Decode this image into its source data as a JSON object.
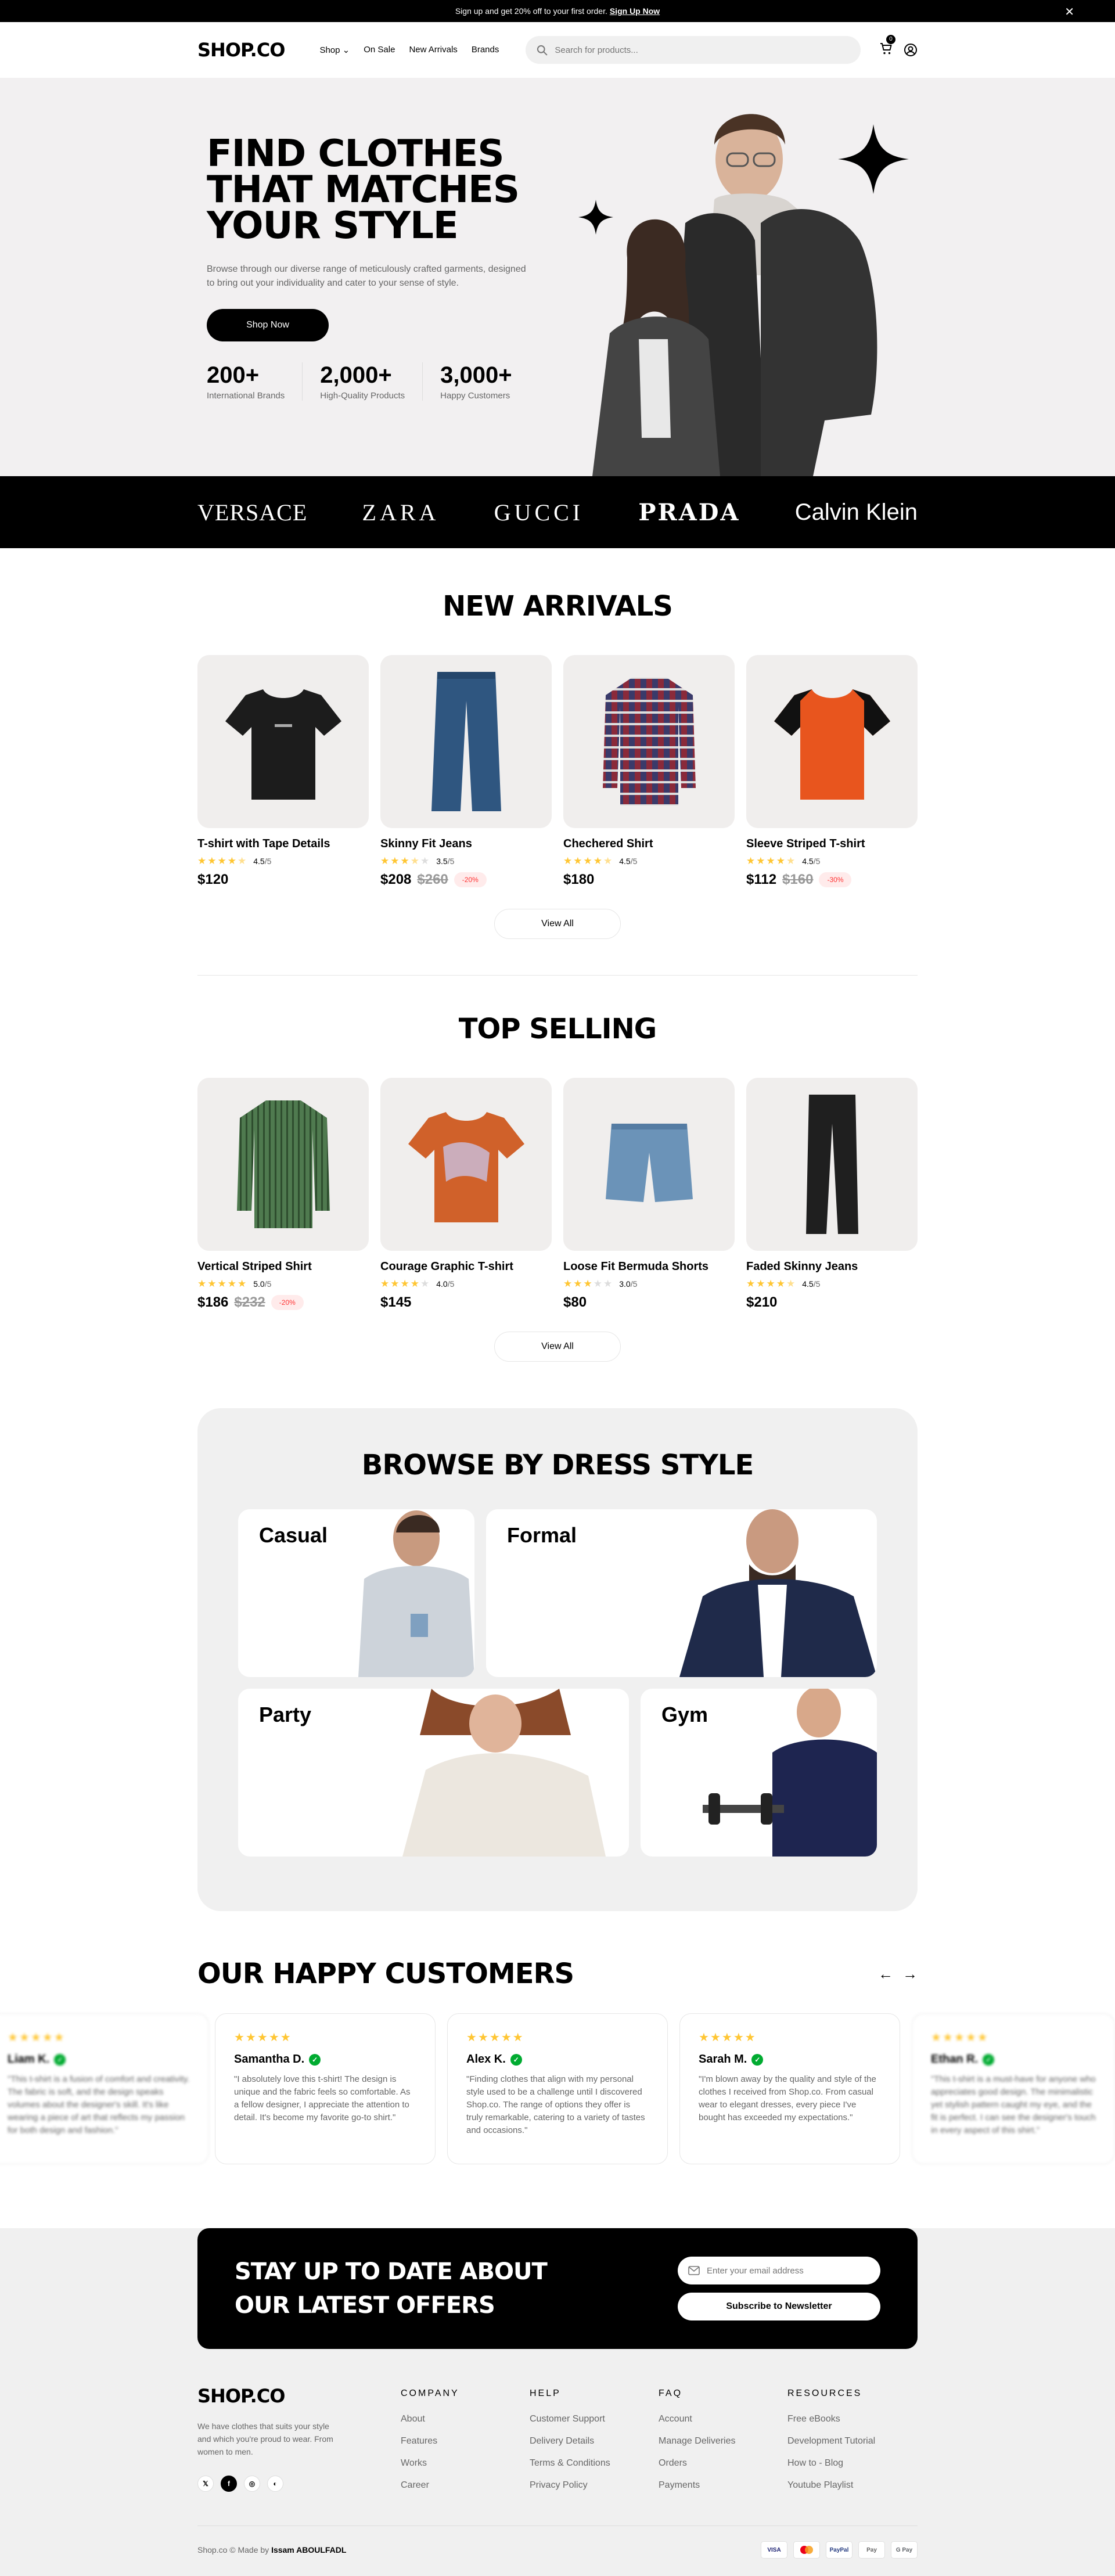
{
  "banner": {
    "text": "Sign up and get 20% off to your first order.",
    "link": "Sign Up Now"
  },
  "nav": {
    "logo": "SHOP.CO",
    "menu": [
      "Shop",
      "On Sale",
      "New Arrivals",
      "Brands"
    ],
    "search_placeholder": "Search for products...",
    "cart_count": "0"
  },
  "hero": {
    "title": "FIND CLOTHES THAT MATCHES YOUR STYLE",
    "description": "Browse through our diverse range of meticulously crafted garments, designed to bring out your individuality and cater to your sense of style.",
    "cta": "Shop Now",
    "stats": [
      {
        "num": "200+",
        "label": "International Brands"
      },
      {
        "num": "2,000+",
        "label": "High-Quality Products"
      },
      {
        "num": "3,000+",
        "label": "Happy Customers"
      }
    ]
  },
  "brands": [
    "VERSACE",
    "ZARA",
    "GUCCI",
    "PRADA",
    "Calvin Klein"
  ],
  "new_arrivals": {
    "title": "NEW ARRIVALS",
    "view_all": "View All",
    "products": [
      {
        "name": "T-shirt with Tape Details",
        "stars": 4.5,
        "score": "4.5",
        "price": "$120",
        "old": "",
        "discount": ""
      },
      {
        "name": "Skinny Fit Jeans",
        "stars": 3.5,
        "score": "3.5",
        "price": "$208",
        "old": "$260",
        "discount": "-20%"
      },
      {
        "name": "Chechered Shirt",
        "stars": 4.5,
        "score": "4.5",
        "price": "$180",
        "old": "",
        "discount": ""
      },
      {
        "name": "Sleeve Striped T-shirt",
        "stars": 4.5,
        "score": "4.5",
        "price": "$112",
        "old": "$160",
        "discount": "-30%"
      }
    ]
  },
  "top_selling": {
    "title": "TOP SELLING",
    "view_all": "View All",
    "products": [
      {
        "name": "Vertical Striped Shirt",
        "stars": 5.0,
        "score": "5.0",
        "price": "$186",
        "old": "$232",
        "discount": "-20%"
      },
      {
        "name": "Courage Graphic T-shirt",
        "stars": 4.0,
        "score": "4.0",
        "price": "$145",
        "old": "",
        "discount": ""
      },
      {
        "name": "Loose Fit Bermuda Shorts",
        "stars": 3.0,
        "score": "3.0",
        "price": "$80",
        "old": "",
        "discount": ""
      },
      {
        "name": "Faded Skinny Jeans",
        "stars": 4.5,
        "score": "4.5",
        "price": "$210",
        "old": "",
        "discount": ""
      }
    ]
  },
  "score_suffix": "/5",
  "browse": {
    "title": "BROWSE BY DRESS STYLE",
    "tiles": [
      "Casual",
      "Formal",
      "Party",
      "Gym"
    ]
  },
  "testimonials": {
    "title": "OUR HAPPY CUSTOMERS",
    "reviews": [
      {
        "name": "Liam K.",
        "text": "\"This t-shirt is a fusion of comfort and creativity. The fabric is soft, and the design speaks volumes about the designer's skill. It's like wearing a piece of art that reflects my passion for both design and fashion.\""
      },
      {
        "name": "Samantha D.",
        "text": "\"I absolutely love this t-shirt! The design is unique and the fabric feels so comfortable. As a fellow designer, I appreciate the attention to detail. It's become my favorite go-to shirt.\""
      },
      {
        "name": "Alex K.",
        "text": "\"Finding clothes that align with my personal style used to be a challenge until I discovered Shop.co. The range of options they offer is truly remarkable, catering to a variety of tastes and occasions.\""
      },
      {
        "name": "Sarah M.",
        "text": "\"I'm blown away by the quality and style of the clothes I received from Shop.co. From casual wear to elegant dresses, every piece I've bought has exceeded my expectations.\""
      },
      {
        "name": "Ethan R.",
        "text": "\"This t-shirt is a must-have for anyone who appreciates good design. The minimalistic yet stylish pattern caught my eye, and the fit is perfect. I can see the designer's touch in every aspect of this shirt.\""
      }
    ]
  },
  "newsletter": {
    "title": "STAY UP TO DATE ABOUT OUR LATEST OFFERS",
    "placeholder": "Enter your email address",
    "button": "Subscribe to Newsletter"
  },
  "footer": {
    "logo": "SHOP.CO",
    "about": "We have clothes that suits your style and which you're proud to wear. From women to men.",
    "columns": [
      {
        "title": "COMPANY",
        "links": [
          "About",
          "Features",
          "Works",
          "Career"
        ]
      },
      {
        "title": "HELP",
        "links": [
          "Customer Support",
          "Delivery Details",
          "Terms & Conditions",
          "Privacy Policy"
        ]
      },
      {
        "title": "FAQ",
        "links": [
          "Account",
          "Manage Deliveries",
          "Orders",
          "Payments"
        ]
      },
      {
        "title": "RESOURCES",
        "links": [
          "Free eBooks",
          "Development Tutorial",
          "How to - Blog",
          "Youtube Playlist"
        ]
      }
    ],
    "copyright": "Shop.co © Made by",
    "author": "Issam ABOULFADL",
    "payments": [
      "VISA",
      "MC",
      "PayPal",
      "Pay",
      "G Pay"
    ]
  },
  "colors": {
    "star": "#FFC633",
    "discount_bg": "#FFEBEB",
    "discount_text": "#FF3333",
    "verified": "#01AB31"
  }
}
